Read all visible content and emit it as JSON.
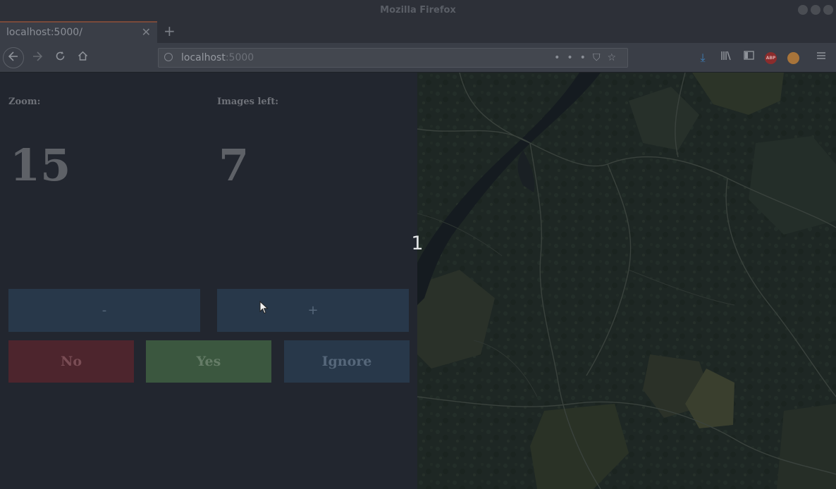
{
  "window": {
    "title": "Mozilla Firefox"
  },
  "tab": {
    "title": "localhost:5000/",
    "close_glyph": "✕",
    "new_tab_glyph": "+"
  },
  "nav": {
    "url_host": "localhost",
    "url_port": ":5000",
    "icons": [
      "back-icon",
      "forward-icon",
      "reload-icon",
      "home-icon",
      "page-actions-icon",
      "pocket-icon",
      "bookmark-star-icon",
      "downloads-icon",
      "library-icon",
      "sidebar-icon",
      "adblock-icon",
      "extension-icon",
      "menu-icon"
    ]
  },
  "zoom": {
    "label": "Zoom:",
    "value": "15"
  },
  "images": {
    "label": "Images left:",
    "value": "7"
  },
  "buttons": {
    "zoom_out": "-",
    "zoom_in": "+",
    "no": "No",
    "yes": "Yes",
    "ignore": "Ignore"
  },
  "map": {
    "counter": "1"
  },
  "colors": {
    "no": "#4d252d",
    "yes": "#3b573f",
    "ignore": "#28384a",
    "background": "#22262f"
  }
}
